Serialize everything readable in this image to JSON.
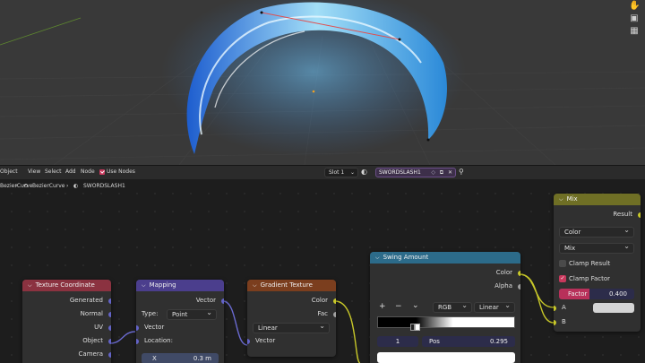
{
  "header": {
    "menu_object": "Object",
    "menu_view": "View",
    "menu_select": "Select",
    "menu_add": "Add",
    "menu_node": "Node",
    "use_nodes_label": "Use Nodes",
    "slot_label": "Slot 1",
    "material_name": "SWORDSLASH1"
  },
  "breadcrumb": {
    "item1": "BezierCurve",
    "item2": "BezierCurve",
    "item3": "SWORDSLASH1"
  },
  "nodes": {
    "texcoord": {
      "title": "Texture Coordinate",
      "outputs": [
        "Generated",
        "Normal",
        "UV",
        "Object",
        "Camera"
      ]
    },
    "mapping": {
      "title": "Mapping",
      "out_vector": "Vector",
      "type_label": "Type:",
      "type_value": "Point",
      "in_vector": "Vector",
      "location_label": "Location:",
      "x_label": "X",
      "x_value": "0.3 m"
    },
    "gradient": {
      "title": "Gradient Texture",
      "out_color": "Color",
      "out_fac": "Fac",
      "interp_value": "Linear",
      "in_vector": "Vector"
    },
    "swing": {
      "title": "Swing Amount",
      "out_color": "Color",
      "out_alpha": "Alpha",
      "plus": "+",
      "minus": "−",
      "mode": "RGB",
      "interp": "Linear",
      "index": "1",
      "pos_label": "Pos",
      "pos_value": "0.295"
    },
    "mix": {
      "title": "Mix",
      "out_result": "Result",
      "data_type": "Color",
      "blend": "Mix",
      "clamp_result": "Clamp Result",
      "clamp_factor": "Clamp Factor",
      "factor_label": "Factor",
      "factor_value": "0.400",
      "in_a": "A",
      "in_b": "B"
    }
  },
  "colors": {
    "texcoord_header": "#8b3240",
    "mapping_header": "#4b3e8d",
    "gradient_header": "#7b3e1e",
    "swing_header": "#2c6b8a",
    "mix_header": "#6f6f25",
    "accent": "#c8385c"
  }
}
